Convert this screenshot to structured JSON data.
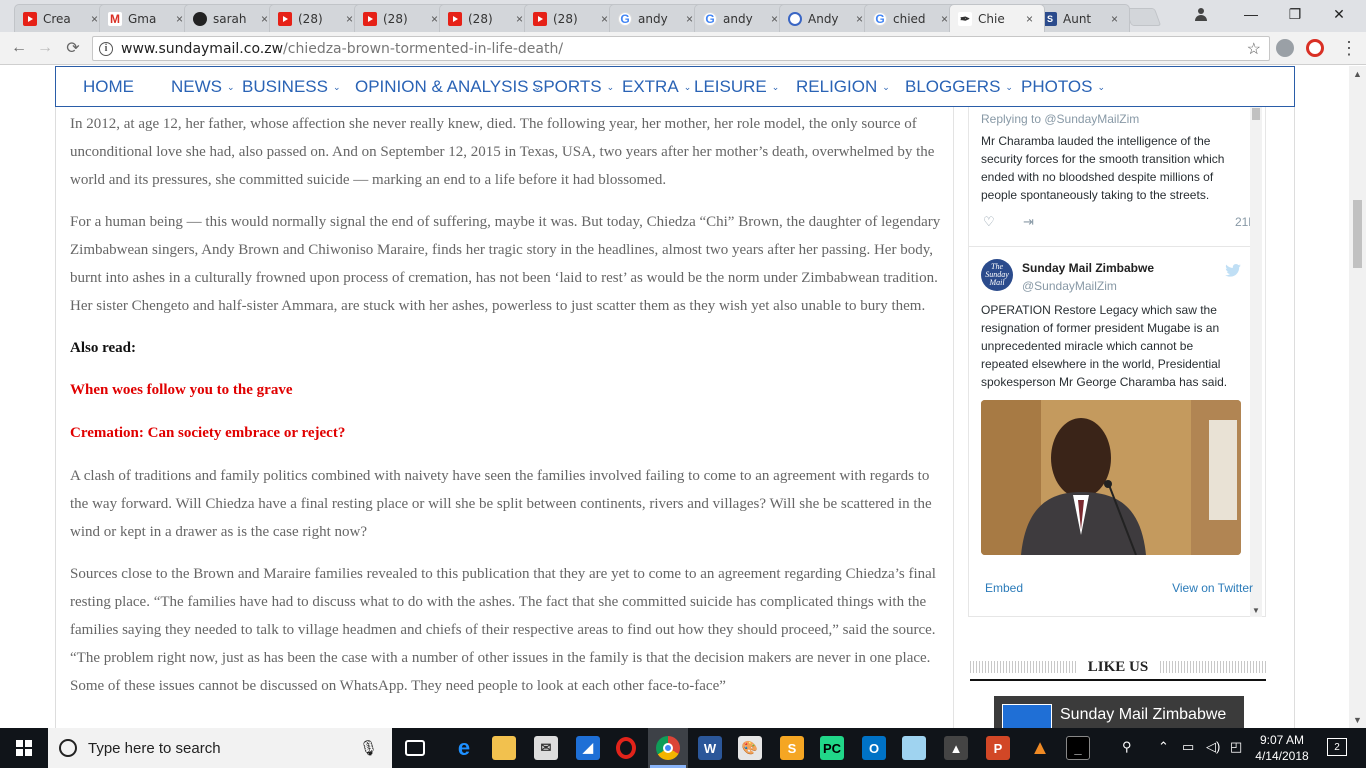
{
  "browser": {
    "tabs": [
      {
        "icon": "youtube-icon",
        "title": "Crea",
        "active": false
      },
      {
        "icon": "gmail-icon",
        "title": "Gma",
        "active": false
      },
      {
        "icon": "github-icon",
        "title": "sarah",
        "active": false
      },
      {
        "icon": "youtube-icon",
        "title": "(28) ",
        "active": false
      },
      {
        "icon": "youtube-icon",
        "title": "(28) ",
        "active": false
      },
      {
        "icon": "youtube-icon",
        "title": "(28) ",
        "active": false
      },
      {
        "icon": "youtube-icon",
        "title": "(28) ",
        "active": false
      },
      {
        "icon": "google-icon",
        "title": "andy",
        "active": false
      },
      {
        "icon": "google-icon",
        "title": "andy",
        "active": false
      },
      {
        "icon": "loading-icon",
        "title": "Andy",
        "active": false
      },
      {
        "icon": "google-icon",
        "title": "chied",
        "active": false
      },
      {
        "icon": "sundaymail-feather-icon",
        "title": "Chie",
        "active": true
      },
      {
        "icon": "sundaymail-s-icon",
        "title": "Aunt",
        "active": false
      }
    ],
    "close_glyph": "×",
    "url_domain": "www.sundaymail.co.zw",
    "url_path": "/chiedza-brown-tormented-in-life-death/"
  },
  "nav": {
    "items": [
      {
        "label": "HOME",
        "dropdown": false
      },
      {
        "label": "NEWS",
        "dropdown": true
      },
      {
        "label": "BUSINESS",
        "dropdown": true
      },
      {
        "label": "OPINION & ANALYSIS",
        "dropdown": true
      },
      {
        "label": "SPORTS",
        "dropdown": true
      },
      {
        "label": "EXTRA",
        "dropdown": true
      },
      {
        "label": "LEISURE",
        "dropdown": true
      },
      {
        "label": "RELIGION",
        "dropdown": true
      },
      {
        "label": "BLOGGERS",
        "dropdown": true
      },
      {
        "label": "PHOTOS",
        "dropdown": true
      }
    ]
  },
  "article": {
    "p1": "In 2012, at age 12, her father, whose affection she never really knew, died. The following year, her mother, her role model, the only source of unconditional love she had, also passed on.  And on September 12, 2015 in Texas, USA, two years after her mother’s death, overwhelmed by the world and its pressures, she committed suicide — marking an end to a life before it had blossomed.",
    "p2": "For a human being — this would normally signal the end of suffering, maybe it was. But today, Chiedza “Chi” Brown, the daughter of legendary Zimbabwean singers, Andy Brown and Chiwoniso Maraire, finds her tragic story in the headlines, almost two years after her passing. Her body, burnt into ashes in a culturally frowned upon process of cremation, has not been ‘laid to rest’ as would be the norm under Zimbabwean tradition. Her sister Chengeto and half-sister Ammara, are stuck with her ashes, powerless to just scatter them as they wish yet also unable to bury them.",
    "also_read": "Also read:",
    "link1": "When woes follow you to the grave",
    "link2": "Cremation: Can society embrace or reject?",
    "p3": "A clash of traditions and family politics combined with naivety have seen the families involved failing to come to an agreement with regards to the way forward. Will Chiedza have a final resting place or will she be split between continents, rivers and villages? Will she be scattered in the wind or kept in a drawer as is the case right now?",
    "p4": "Sources close to the Brown and Maraire families revealed to this publication that they are yet to come to an agreement regarding Chiedza’s final resting place.  “The families have had to discuss what to do with the ashes. The fact that she committed suicide has complicated things with the families saying they needed to talk to village headmen and chiefs of their respective areas to find out how they should proceed,” said the source. “The problem right now, just as has been the case with a number of other issues in the family is that the decision makers are never in one place. Some of these issues cannot be discussed on WhatsApp. They need people to look at each other face-to-face”"
  },
  "twitter": {
    "reply_to": "Replying to @SundayMailZim",
    "tweet1_text": "Mr Charamba lauded the intelligence of the security forces for the smooth transition which ended with no bloodshed despite millions of people spontaneously taking to the streets.",
    "tweet1_time": "21h",
    "account_name": "Sunday Mail Zimbabwe",
    "account_handle": "@SundayMailZim",
    "avatar_text": "The Sunday Mail",
    "tweet2_text": "OPERATION Restore Legacy which saw the resignation of former president Mugabe is an unprecedented miracle which cannot be repeated elsewhere in the world, Presidential spokesperson Mr George Charamba has said.",
    "embed": "Embed",
    "view_on_twitter": "View on Twitter"
  },
  "sidebar": {
    "like_us": "LIKE US",
    "fb_page_name": "Sunday Mail Zimbabwe"
  },
  "taskbar": {
    "search_placeholder": "Type here to search",
    "time": "9:07 AM",
    "date": "4/14/2018",
    "notifications": "2"
  }
}
